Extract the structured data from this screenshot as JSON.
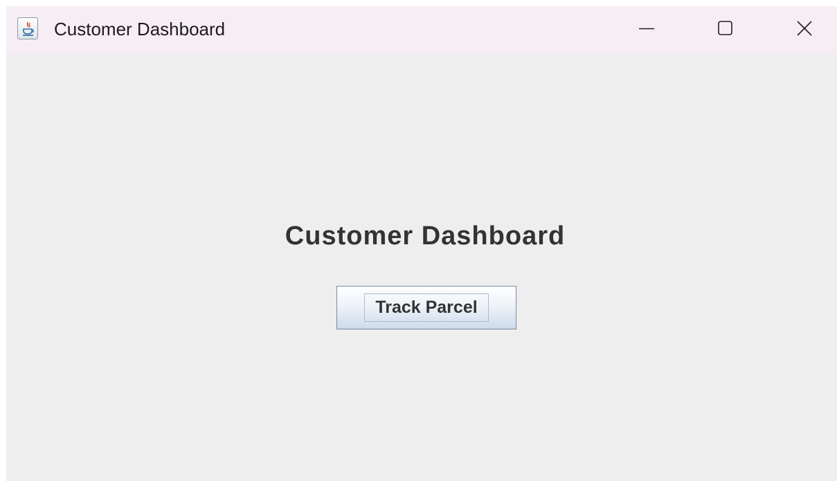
{
  "window": {
    "title": "Customer Dashboard",
    "app_icon": "java-cup-icon",
    "controls": [
      "minimize-icon",
      "maximize-icon",
      "close-icon"
    ]
  },
  "main": {
    "heading": "Customer Dashboard",
    "track_button_label": "Track Parcel"
  },
  "colors": {
    "titlebar_bg": "#f7eef5",
    "content_bg": "#eeeeee",
    "text": "#333333",
    "button_border": "#7a8aa3"
  }
}
